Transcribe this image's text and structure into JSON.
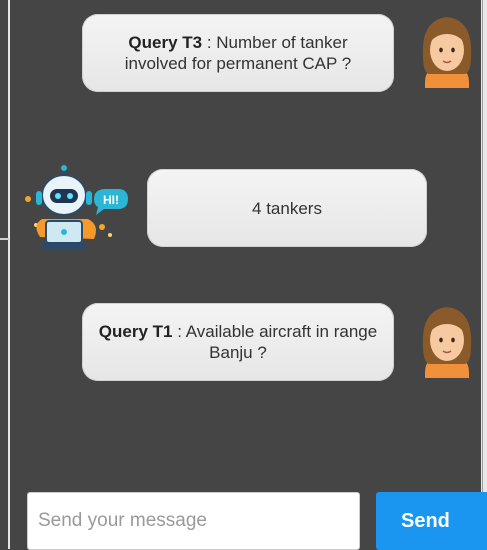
{
  "conversation": [
    {
      "sender": "user",
      "label": "Query T3",
      "separator": " : ",
      "text": "Number of tanker involved for permanent CAP ?"
    },
    {
      "sender": "bot",
      "text": "4 tankers",
      "badge": "HI!"
    },
    {
      "sender": "user",
      "label": "Query T1",
      "separator": " : ",
      "text": "Available aircraft in range Banju ?"
    }
  ],
  "composer": {
    "placeholder": "Send your message",
    "value": "",
    "send_label": "Send"
  },
  "colors": {
    "background": "#454545",
    "bubble": "#eeeeee",
    "send_button": "#1a96f0",
    "avatar_hair": "#8a5a2b",
    "avatar_skin": "#f7c9a0",
    "bot_accent": "#2bb6d6"
  },
  "icons": {
    "user_avatar": "woman-avatar-icon",
    "bot_avatar": "robot-assistant-icon"
  }
}
